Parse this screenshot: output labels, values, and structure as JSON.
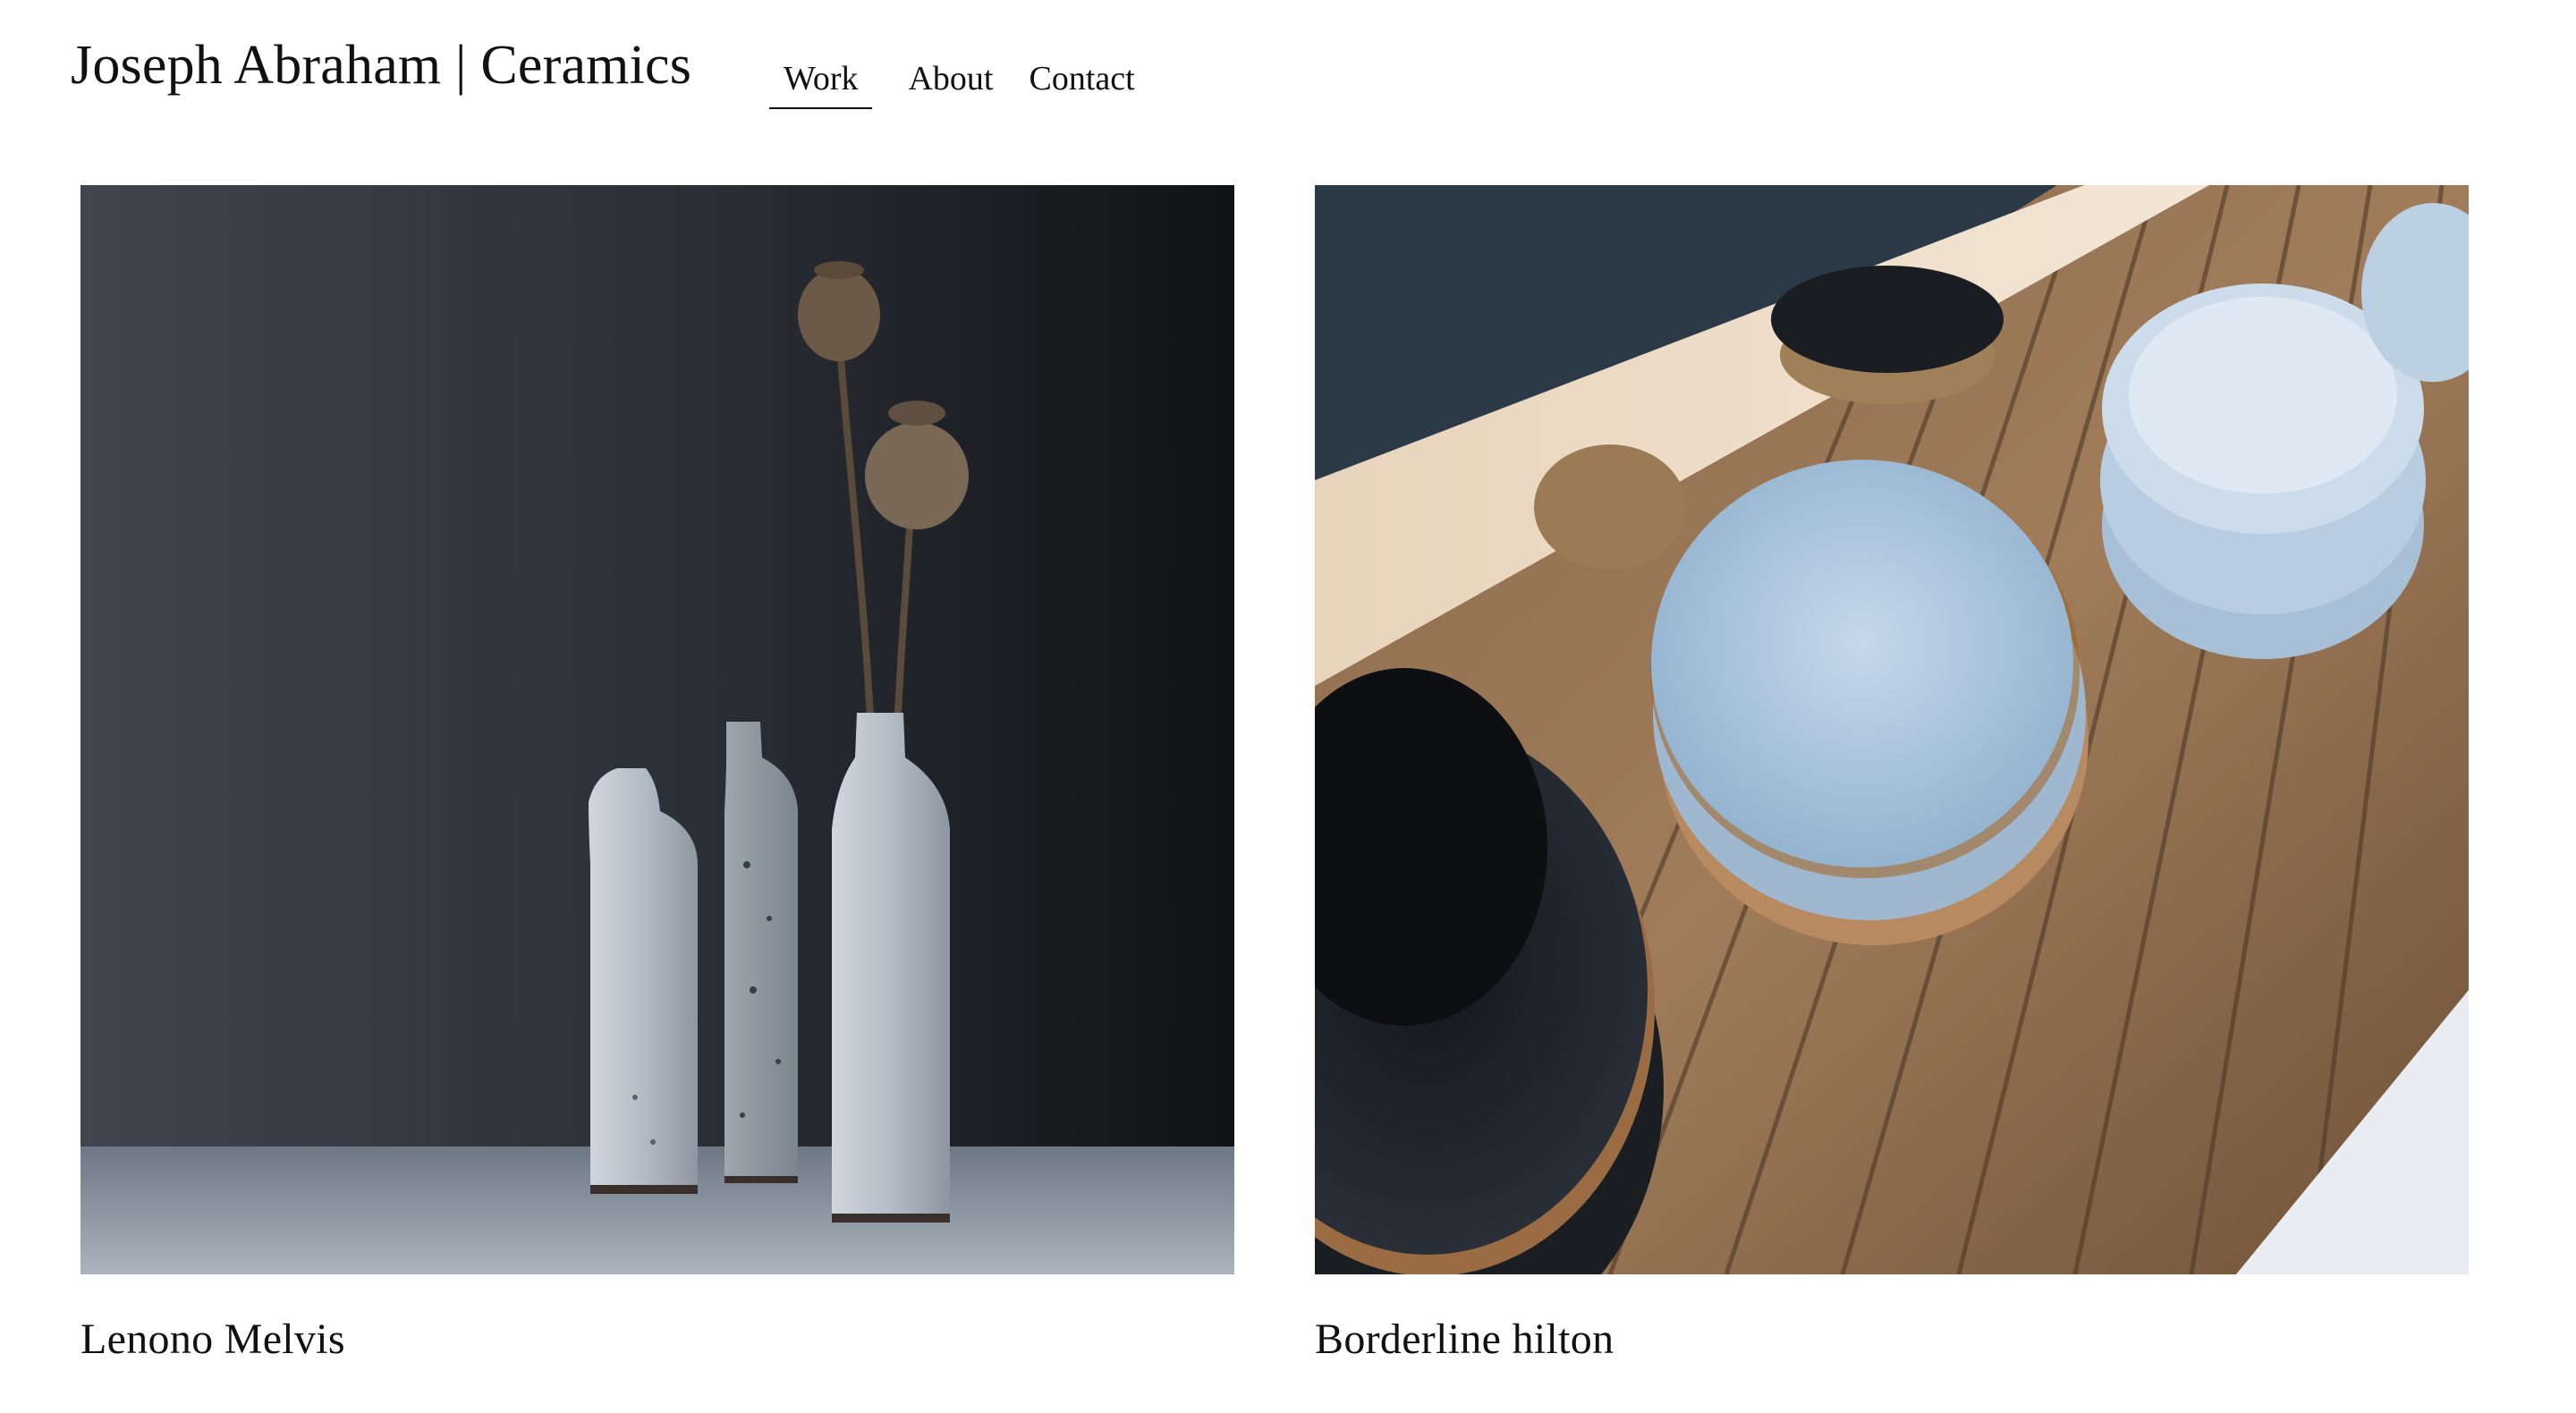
{
  "site": {
    "title": "Joseph Abraham | Ceramics"
  },
  "nav": {
    "items": [
      {
        "label": "Work",
        "active": true
      },
      {
        "label": "About",
        "active": false
      },
      {
        "label": "Contact",
        "active": false
      }
    ]
  },
  "projects": [
    {
      "title": "Lenono Melvis"
    },
    {
      "title": "Borderline hilton"
    }
  ]
}
